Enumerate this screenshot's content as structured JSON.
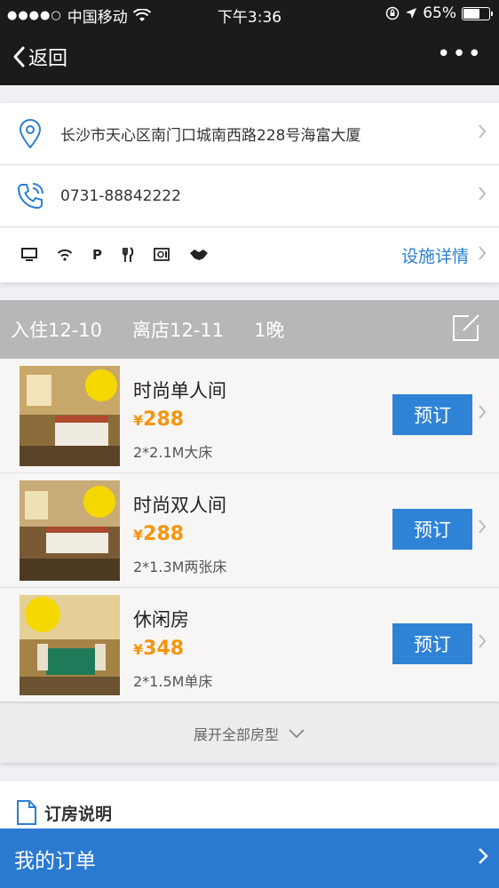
{
  "status_bar": {
    "signal": "●●●●○",
    "carrier": "中国移动",
    "time": "下午3:36",
    "battery": "65%",
    "battery_level": 0.65
  },
  "nav": {
    "back_label": "返回",
    "more_label": "•••"
  },
  "hotel": {
    "address": "长沙市天心区南门口城南西路228号海富大厦",
    "phone": "0731-88842222",
    "facilities": [
      "computer-icon",
      "wifi-icon",
      "parking-icon",
      "restaurant-icon",
      "safe-icon",
      "handshake-icon"
    ],
    "parking_glyph": "P",
    "facility_detail_label": "设施详情"
  },
  "dates": {
    "checkin": "入住12-10",
    "checkout": "离店12-11",
    "nights": "1晚"
  },
  "rooms": [
    {
      "name": "时尚单人间",
      "currency": "¥",
      "price": "288",
      "bed": "2*2.1M大床",
      "book_label": "预订"
    },
    {
      "name": "时尚双人间",
      "currency": "¥",
      "price": "288",
      "bed": "2*1.3M两张床",
      "book_label": "预订"
    },
    {
      "name": "休闲房",
      "currency": "¥",
      "price": "348",
      "bed": "2*1.5M单床",
      "book_label": "预订"
    }
  ],
  "expand_label": "展开全部房型",
  "notes_title": "订房说明",
  "footer_label": "我的订单",
  "colors": {
    "accent": "#2f83d6",
    "price": "#f4950c",
    "dark_bar": "#1b1b1b"
  }
}
